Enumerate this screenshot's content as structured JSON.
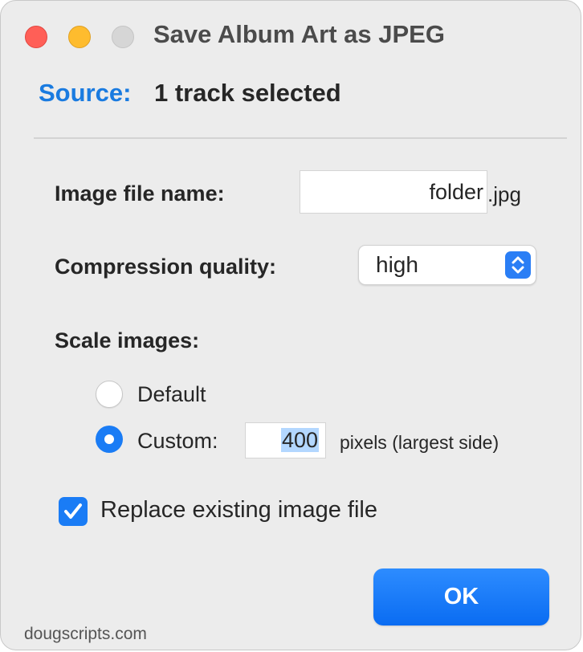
{
  "window": {
    "title": "Save Album Art as JPEG"
  },
  "source": {
    "label": "Source:",
    "value": "1 track selected"
  },
  "filename": {
    "label": "Image file name:",
    "value": "folder",
    "extension": ".jpg"
  },
  "compression": {
    "label": "Compression quality:",
    "selected": "high"
  },
  "scale": {
    "label": "Scale images:",
    "options": [
      {
        "label": "Default",
        "selected": false
      },
      {
        "label": "Custom:",
        "selected": true
      }
    ],
    "custom_value": "400",
    "custom_hint": "pixels (largest side)"
  },
  "replace": {
    "label": "Replace existing image file",
    "checked": true
  },
  "ok_button": {
    "label": "OK"
  },
  "footer": {
    "text": "dougscripts.com"
  },
  "colors": {
    "accent": "#1a7cf5",
    "source_label": "#1a7be0",
    "close": "#ff5f57",
    "minimize": "#febc2e",
    "zoom": "#d6d6d6"
  }
}
